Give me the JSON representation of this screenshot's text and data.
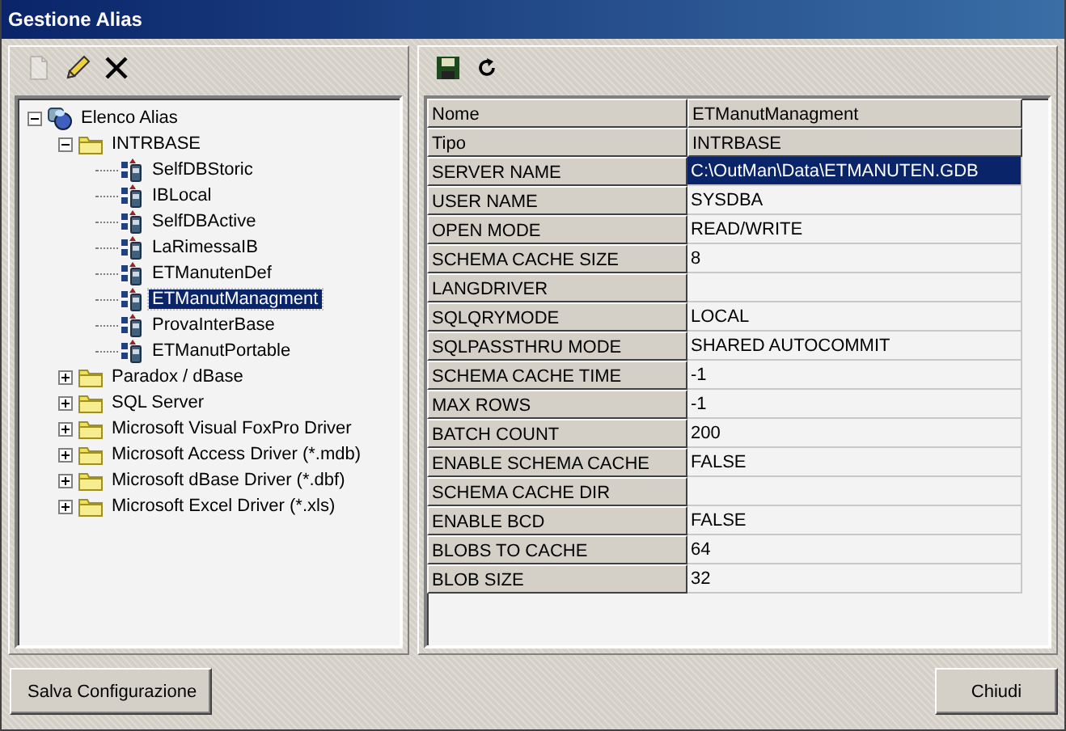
{
  "window": {
    "title": "Gestione Alias"
  },
  "left_toolbar": [
    {
      "kind": "new",
      "disabled": true
    },
    {
      "kind": "edit",
      "disabled": false
    },
    {
      "kind": "delete",
      "disabled": false
    }
  ],
  "tree": [
    {
      "label": "Elenco Alias",
      "kind": "root",
      "expanded": true,
      "selected": false,
      "children": [
        {
          "label": "INTRBASE",
          "kind": "folder",
          "expanded": true,
          "selected": false,
          "children": [
            {
              "label": "SelfDBStoric",
              "kind": "alias",
              "selected": false
            },
            {
              "label": "IBLocal",
              "kind": "alias",
              "selected": false
            },
            {
              "label": "SelfDBActive",
              "kind": "alias",
              "selected": false
            },
            {
              "label": "LaRimessaIB",
              "kind": "alias",
              "selected": false
            },
            {
              "label": "ETManutenDef",
              "kind": "alias",
              "selected": false
            },
            {
              "label": "ETManutManagment",
              "kind": "alias",
              "selected": true
            },
            {
              "label": "ProvaInterBase",
              "kind": "alias",
              "selected": false
            },
            {
              "label": "ETManutPortable",
              "kind": "alias",
              "selected": false
            }
          ]
        },
        {
          "label": "Paradox / dBase",
          "kind": "folder",
          "expanded": false,
          "selected": false
        },
        {
          "label": "SQL Server",
          "kind": "folder",
          "expanded": false,
          "selected": false
        },
        {
          "label": "Microsoft Visual FoxPro Driver",
          "kind": "folder",
          "expanded": false,
          "selected": false
        },
        {
          "label": "Microsoft Access Driver (*.mdb)",
          "kind": "folder",
          "expanded": false,
          "selected": false
        },
        {
          "label": "Microsoft dBase Driver (*.dbf)",
          "kind": "folder",
          "expanded": false,
          "selected": false
        },
        {
          "label": "Microsoft Excel Driver (*.xls)",
          "kind": "folder",
          "expanded": false,
          "selected": false
        }
      ]
    }
  ],
  "right_toolbar": [
    {
      "kind": "save"
    },
    {
      "kind": "refresh"
    }
  ],
  "grid": {
    "rows": [
      {
        "name": "Nome",
        "value": "ETManutManagment",
        "fixed": true
      },
      {
        "name": "Tipo",
        "value": "INTRBASE",
        "fixed": true
      },
      {
        "name": "SERVER NAME",
        "value": "C:\\OutMan\\Data\\ETMANUTEN.GDB",
        "fixed": false,
        "selected": true
      },
      {
        "name": "USER NAME",
        "value": "SYSDBA",
        "fixed": false,
        "selected": false
      },
      {
        "name": "OPEN MODE",
        "value": "READ/WRITE",
        "fixed": false,
        "selected": false
      },
      {
        "name": "SCHEMA CACHE SIZE",
        "value": "8",
        "fixed": false,
        "selected": false
      },
      {
        "name": "LANGDRIVER",
        "fixed": false,
        "selected": false
      },
      {
        "name": "SQLQRYMODE",
        "value": "LOCAL",
        "fixed": false,
        "selected": false
      },
      {
        "name": "SQLPASSTHRU MODE",
        "value": "SHARED AUTOCOMMIT",
        "fixed": false,
        "selected": false
      },
      {
        "name": "SCHEMA CACHE TIME",
        "value": "-1",
        "fixed": false,
        "selected": false
      },
      {
        "name": "MAX ROWS",
        "value": "-1",
        "fixed": false,
        "selected": false
      },
      {
        "name": "BATCH COUNT",
        "value": "200",
        "fixed": false,
        "selected": false
      },
      {
        "name": "ENABLE SCHEMA CACHE",
        "value": "FALSE",
        "fixed": false,
        "selected": false
      },
      {
        "name": "SCHEMA CACHE DIR",
        "fixed": false,
        "selected": false
      },
      {
        "name": "ENABLE BCD",
        "value": "FALSE",
        "fixed": false,
        "selected": false
      },
      {
        "name": "BLOBS TO CACHE",
        "value": "64",
        "fixed": false,
        "selected": false
      },
      {
        "name": "BLOB SIZE",
        "value": "32",
        "fixed": false,
        "selected": false
      }
    ]
  },
  "buttons": [
    {
      "label": "Salva Configurazione"
    },
    {
      "label": "Chiudi"
    }
  ]
}
